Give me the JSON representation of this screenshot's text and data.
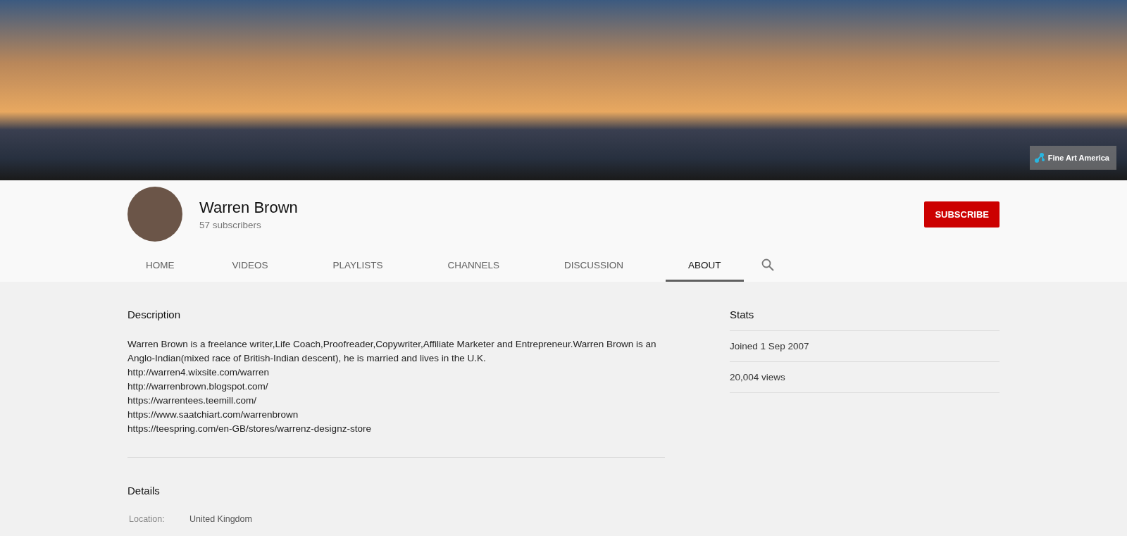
{
  "banner": {
    "link_badge": "Fine Art America"
  },
  "channel": {
    "name": "Warren Brown",
    "subscribers": "57 subscribers",
    "subscribe_button": "SUBSCRIBE"
  },
  "tabs": [
    {
      "label": "HOME",
      "selected": false
    },
    {
      "label": "VIDEOS",
      "selected": false
    },
    {
      "label": "PLAYLISTS",
      "selected": false
    },
    {
      "label": "CHANNELS",
      "selected": false
    },
    {
      "label": "DISCUSSION",
      "selected": false
    },
    {
      "label": "ABOUT",
      "selected": true
    }
  ],
  "description": {
    "heading": "Description",
    "text": "Warren Brown is a freelance writer,Life Coach,Proofreader,Copywriter,Affiliate Marketer and Entrepreneur.Warren Brown is an Anglo-Indian(mixed race of British-Indian descent), he is married and lives in the U.K.",
    "links": [
      "http://warren4.wixsite.com/warren",
      "http://warrenbrown.blogspot.com/",
      "https://warrentees.teemill.com/",
      "https://www.saatchiart.com/warrenbrown",
      "https://teespring.com/en-GB/stores/warrenz-designz-store"
    ]
  },
  "details": {
    "heading": "Details",
    "rows": [
      {
        "label": "Location:",
        "value": "United Kingdom"
      }
    ]
  },
  "stats": {
    "heading": "Stats",
    "items": [
      "Joined 1 Sep 2007",
      "20,004 views"
    ]
  }
}
